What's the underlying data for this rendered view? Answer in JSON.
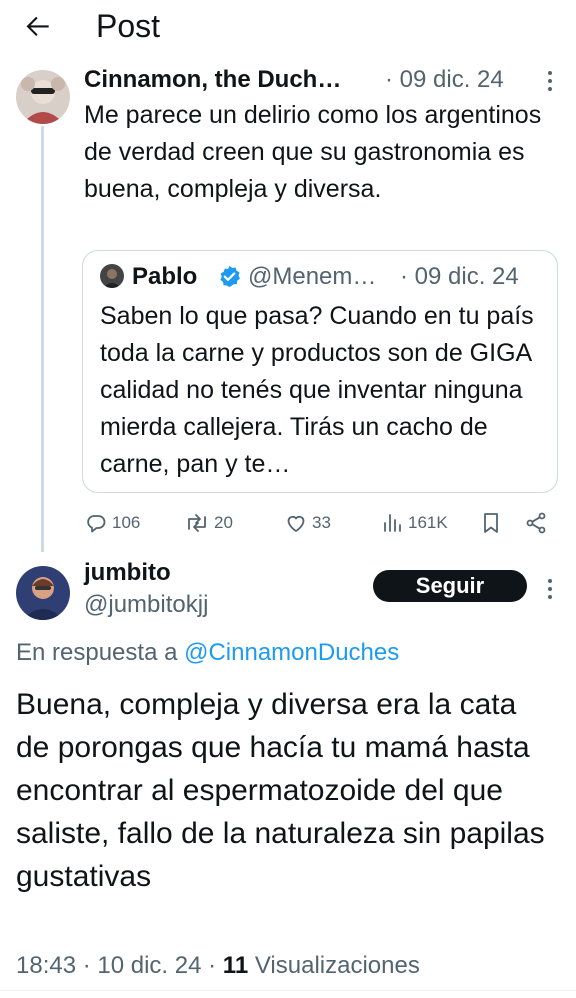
{
  "header": {
    "title": "Post"
  },
  "tweet": {
    "name": "Cinnamon, the Duch…",
    "date": "· 09 dic. 24",
    "text": "Me parece un delirio como los argentinos de verdad creen que su gastronomia es buena, compleja y diversa.",
    "quote": {
      "name": "Pablo",
      "handle": "@Menem…",
      "date": "· 09 dic. 24",
      "text": "Saben lo que pasa? Cuando en tu país toda la carne y productos son de GIGA calidad no tenés que inventar ninguna mierda callejera. Tirás un cacho de carne, pan y te…"
    },
    "actions": {
      "replies": "106",
      "reposts": "20",
      "likes": "33",
      "views": "161K"
    }
  },
  "reply": {
    "name": "jumbito",
    "handle": "@jumbitokjj",
    "follow_label": "Seguir",
    "reply_prefix": "En respuesta a",
    "reply_mention": "@CinnamonDuches",
    "text": "Buena, compleja y diversa era la cata de porongas que hacía tu mamá hasta encontrar al espermatozoide del que saliste, fallo de la naturaleza sin papilas gustativas",
    "time": "18:43",
    "date": "10 dic. 24",
    "views_count": "11",
    "views_label": "Visualizaciones"
  },
  "colors": {
    "accent": "#1d9bf0",
    "text": "#0f1419",
    "muted": "#536471",
    "border": "#cfd9de"
  },
  "icons": [
    "back-arrow-icon",
    "more-icon",
    "verified-icon",
    "reply-icon",
    "repost-icon",
    "like-icon",
    "views-icon",
    "bookmark-icon",
    "share-icon"
  ]
}
